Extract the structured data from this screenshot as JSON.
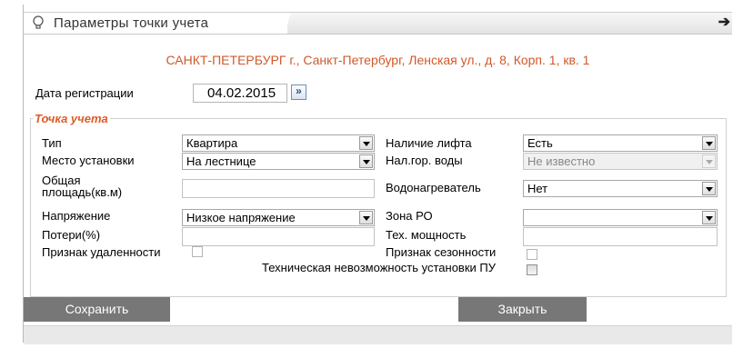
{
  "window": {
    "title": "Параметры точки учета",
    "address": "САНКТ-ПЕТЕРБУРГ г., Санкт-Петербург, Ленская ул., д. 8, Корп. 1, кв. 1"
  },
  "registration": {
    "label": "Дата регистрации",
    "date": "04.02.2015",
    "picker_glyph": "»"
  },
  "group": {
    "legend": "Точка учета",
    "left": {
      "type_label": "Тип",
      "type_value": "Квартира",
      "place_label": "Место установки",
      "place_value": "На лестнице",
      "area_label_1": "Общая",
      "area_label_2": "площадь(кв.м)",
      "area_value": "",
      "voltage_label": "Напряжение",
      "voltage_value": "Низкое напряжение",
      "losses_label": "Потери(%)",
      "losses_value": "",
      "remote_label": "Признак удаленности"
    },
    "right": {
      "lift_label": "Наличие лифта",
      "lift_value": "Есть",
      "hotwater_label": "Нал.гор. воды",
      "hotwater_value": "Не известно",
      "heater_label": "Водонагреватель",
      "heater_value": "Нет",
      "zone_label": "Зона РО",
      "zone_value": "",
      "power_label": "Тех. мощность",
      "power_value": "",
      "seasonal_label": "Признак сезонности"
    },
    "impossible_label": "Техническая невозможность установки ПУ"
  },
  "buttons": {
    "save": "Сохранить",
    "close": "Закрыть"
  },
  "icons": {
    "title_icon": "lightbulb-icon",
    "nav_icon": "arrow-right-icon"
  },
  "colors": {
    "accent": "#e05a25",
    "address": "#d0592a",
    "button_bg": "#777777"
  }
}
